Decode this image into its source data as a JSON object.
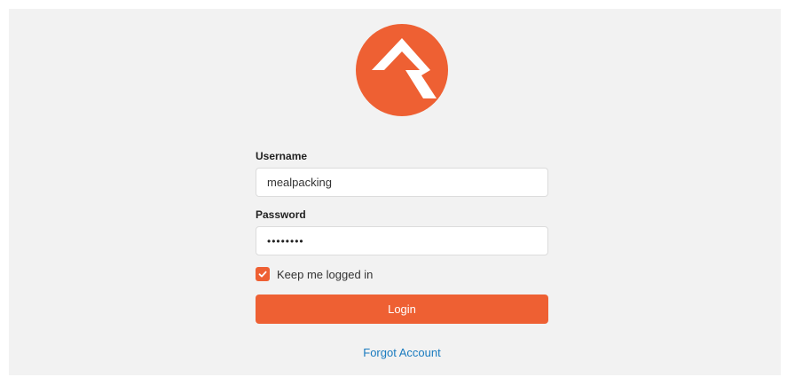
{
  "brand": {
    "logo_icon": "rock-rms-logo-icon",
    "accent_color": "#ee6033",
    "link_color": "#1a7bbf"
  },
  "login_form": {
    "username_label": "Username",
    "username_value": "mealpacking",
    "password_label": "Password",
    "password_display": "••••••••",
    "remember_label": "Keep me logged in",
    "remember_checked": true,
    "login_label": "Login",
    "forgot_label": "Forgot Account"
  }
}
